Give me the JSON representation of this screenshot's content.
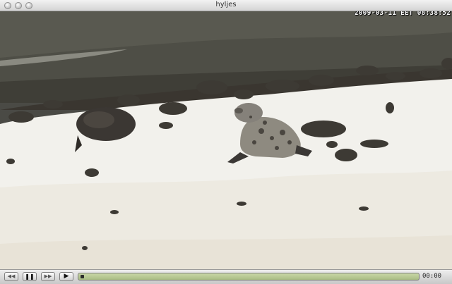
{
  "window": {
    "title": "hyljes"
  },
  "video": {
    "timestamp_overlay": "2009-03-11 EET 08:38:52",
    "scene_description": "two grey seals resting on snow-covered rocky shore by the sea"
  },
  "controls": {
    "rewind_icon": "rewind-icon",
    "pause_icon": "pause-icon",
    "forward_icon": "fast-forward-icon",
    "play_icon": "play-icon",
    "current_time": "00:00",
    "progress": 0.0
  },
  "colors": {
    "seek_bar": "#b4c48f",
    "water": "#55554c",
    "snow": "#f2f1ec"
  }
}
